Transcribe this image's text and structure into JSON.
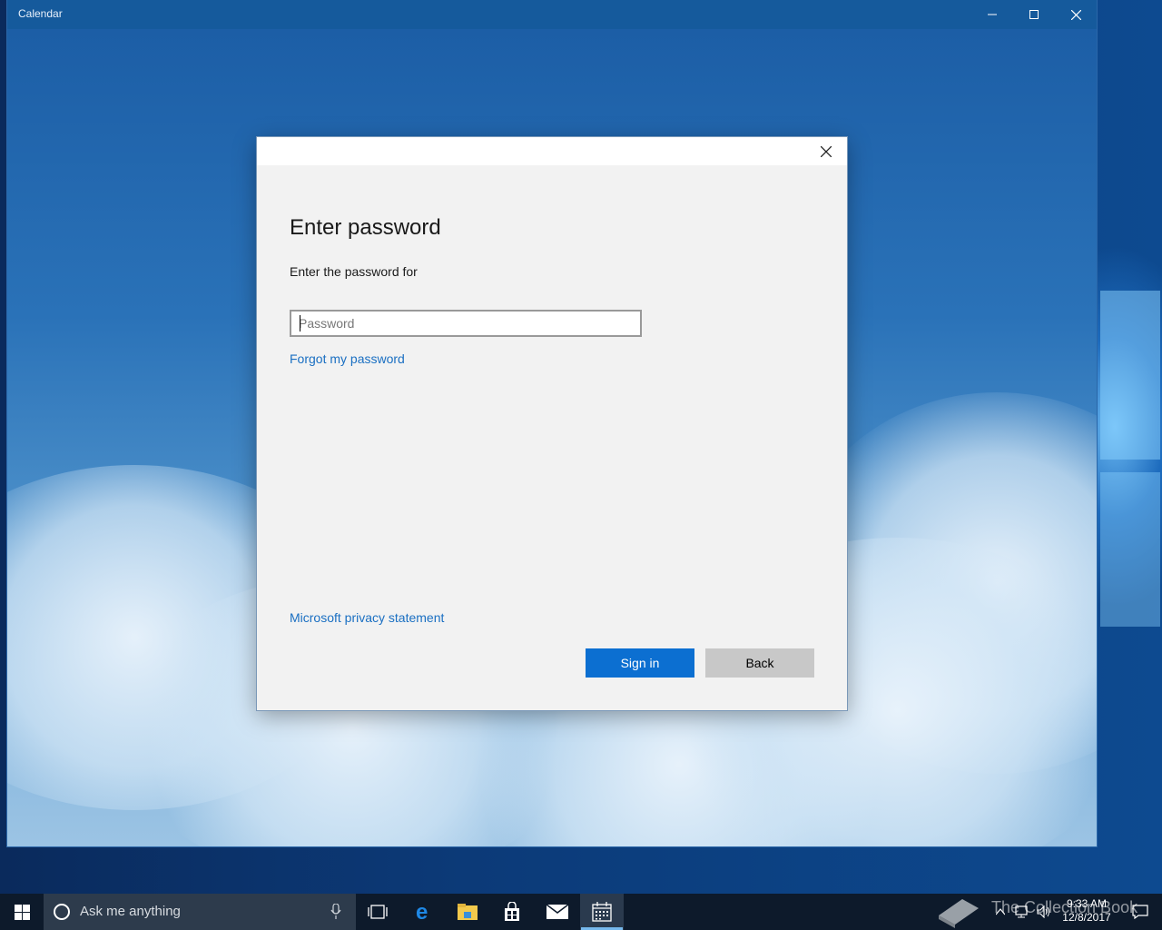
{
  "app": {
    "title": "Calendar",
    "minimize_icon": "minimize-icon",
    "maximize_icon": "maximize-icon",
    "close_icon": "close-icon"
  },
  "dialog": {
    "title": "Enter password",
    "subtitle": "Enter the password for",
    "password": {
      "value": "",
      "placeholder": "Password"
    },
    "forgot_link": "Forgot my password",
    "privacy_link": "Microsoft privacy statement",
    "signin_label": "Sign in",
    "back_label": "Back",
    "primary_color": "#0c6fd1",
    "link_color": "#1a6fc2"
  },
  "taskbar": {
    "search_placeholder": "Ask me anything",
    "clock_time": "9:33 AM",
    "clock_date": "12/8/2017",
    "watermark": "The Collection Book",
    "pinned": [
      "task-view-icon",
      "edge-icon",
      "file-explorer-icon",
      "store-icon",
      "mail-icon",
      "calendar-icon"
    ]
  }
}
